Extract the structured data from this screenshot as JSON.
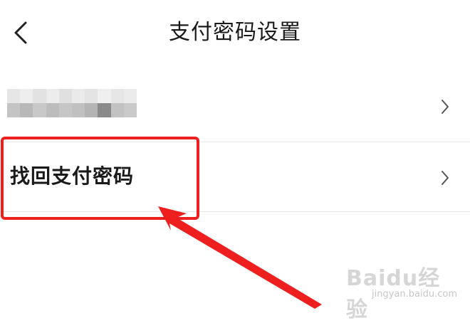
{
  "header": {
    "title": "支付密码设置",
    "back_icon": "chevron-left-icon"
  },
  "rows": [
    {
      "label": "",
      "content": "blurred-redacted",
      "chevron_icon": "chevron-right-icon"
    },
    {
      "label": "找回支付密码",
      "chevron_icon": "chevron-right-icon"
    }
  ],
  "annotation": {
    "highlight_color": "#ee1f1f",
    "arrow_color": "#ee1f1f"
  },
  "watermark": {
    "logo": "Baidu经验",
    "url": "jingyan.baidu.com"
  }
}
